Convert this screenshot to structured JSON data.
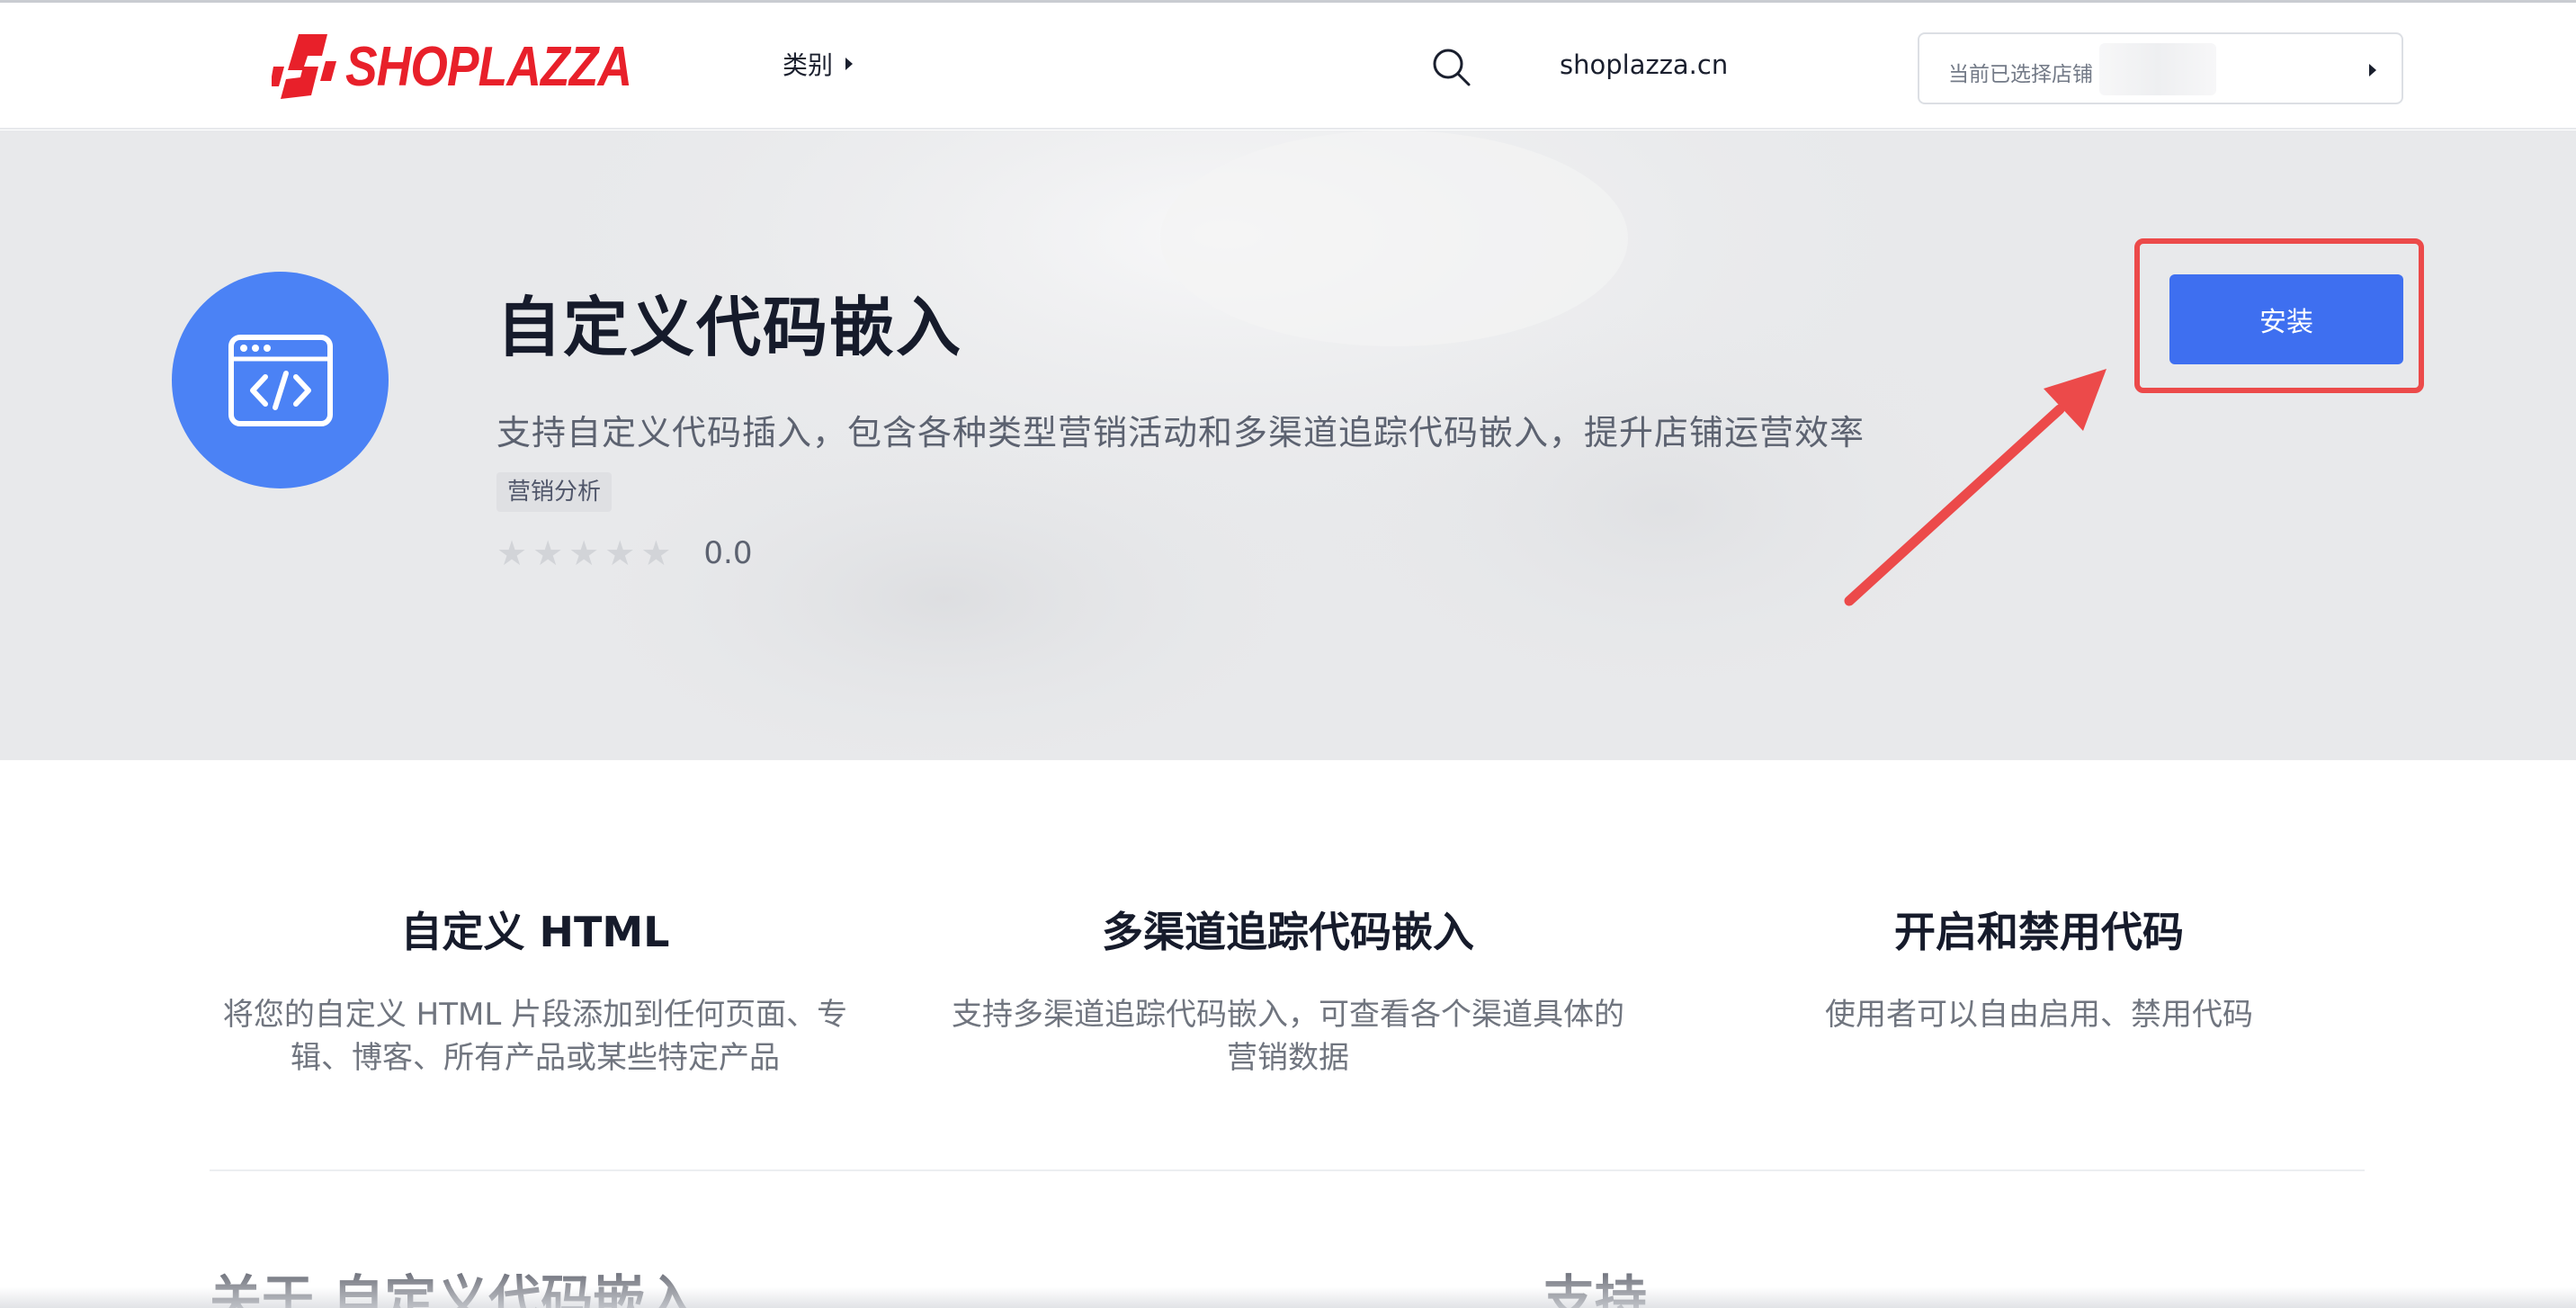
{
  "header": {
    "logo_text": "SHOPLAZZA",
    "category_label": "类别",
    "domain_label": "shoplazza.cn",
    "store_select_placeholder": "当前已选择店铺"
  },
  "app": {
    "title": "自定义代码嵌入",
    "description": "支持自定义代码插入，包含各种类型营销活动和多渠道追踪代码嵌入，提升店铺运营效率",
    "tag": "营销分析",
    "rating": 0.0,
    "rating_text": "0.0",
    "stars_max": 5,
    "install_label": "安装",
    "icon": "code-window-icon"
  },
  "features": [
    {
      "title": "自定义 HTML",
      "description": "将您的自定义 HTML 片段添加到任何页面、专辑、博客、所有产品或某些特定产品"
    },
    {
      "title": "多渠道追踪代码嵌入",
      "description": "支持多渠道追踪代码嵌入，可查看各个渠道具体的营销数据"
    },
    {
      "title": "开启和禁用代码",
      "description": "使用者可以自由启用、禁用代码"
    }
  ],
  "sections": {
    "about_title": "关于 自定义代码嵌入",
    "support_title": "支持"
  },
  "colors": {
    "brand_red": "#e8202a",
    "accent_blue": "#3e6ff0",
    "icon_bg": "#4b82f5",
    "annotation_red": "#ec4a4a"
  }
}
